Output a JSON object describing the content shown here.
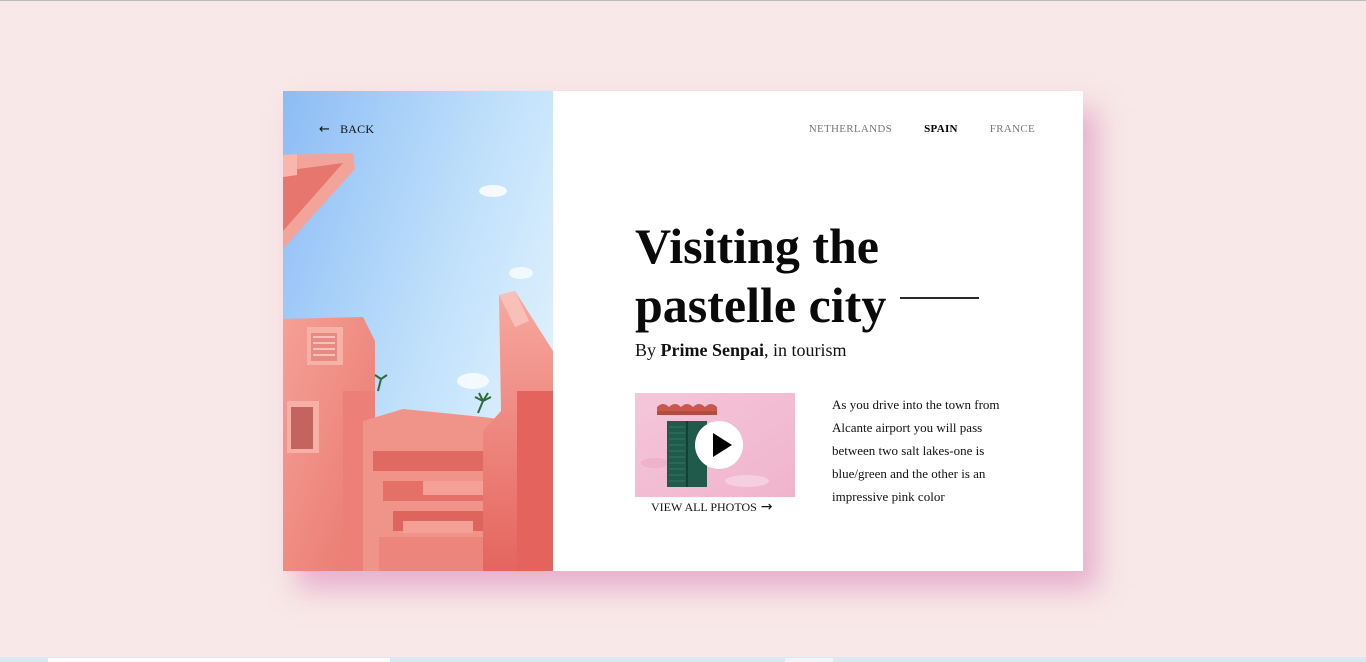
{
  "header": {
    "back_label": "BACK",
    "back_icon": "arrow-left-icon"
  },
  "nav": {
    "items": [
      "NETHERLANDS",
      "SPAIN",
      "FRANCE"
    ],
    "active": "SPAIN"
  },
  "article": {
    "title_line1": "Visiting the",
    "title_line2": "pastelle city",
    "byline_prefix": "By ",
    "author": "Prime Senpai",
    "byline_suffix": ", in tourism",
    "description": "As you drive into the town from Alcante airport you will pass between two salt lakes-one is blue/green and the other is an impressive pink color"
  },
  "media": {
    "view_all_label": "VIEW ALL PHOTOS",
    "play_icon": "play-icon",
    "arrow_icon": "arrow-right-icon"
  },
  "colors": {
    "background": "#f8e8e8",
    "card": "#ffffff",
    "shadow": "#e29cc4",
    "pink_building": "#f08c82",
    "sky": "#a9d3f6"
  }
}
